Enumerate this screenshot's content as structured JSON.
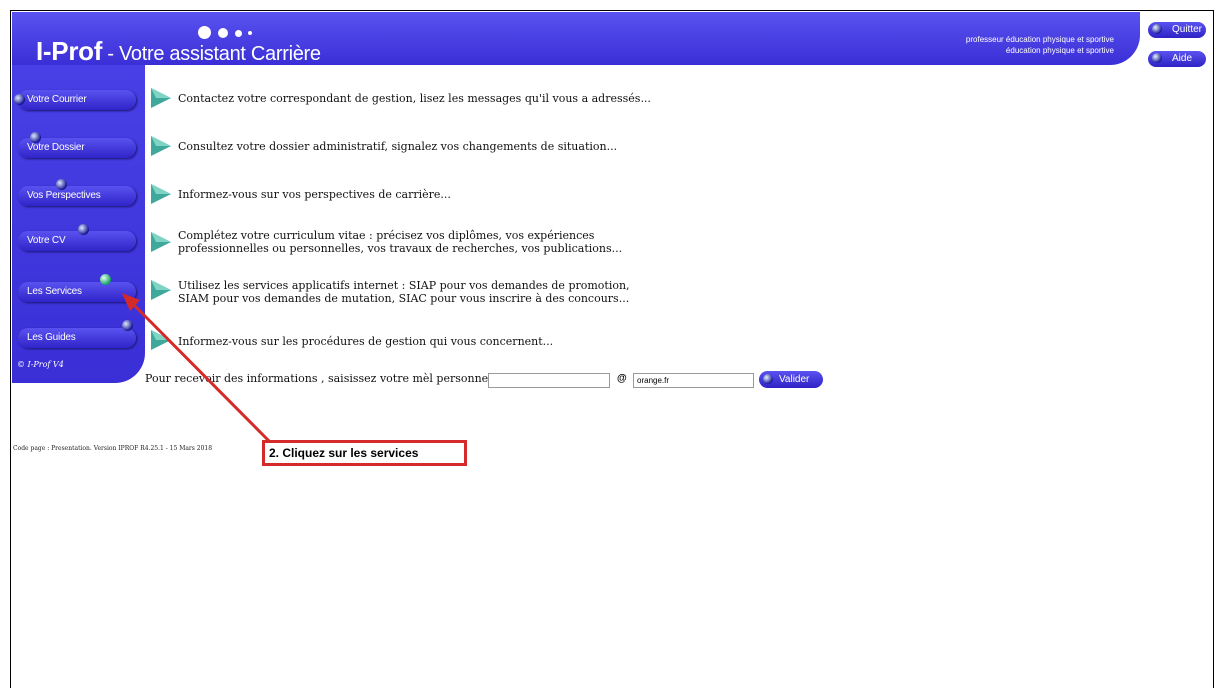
{
  "header": {
    "brand": "I-Prof",
    "tagline": " - Votre assistant Carrière",
    "user_line1": "professeur éducation physique et sportive",
    "user_line2": "éducation physique et sportive",
    "quit_label": "Quitter",
    "help_label": "Aide"
  },
  "sidebar": {
    "items": [
      {
        "label": "Votre Courrier"
      },
      {
        "label": "Votre Dossier"
      },
      {
        "label": "Vos Perspectives"
      },
      {
        "label": "Votre CV"
      },
      {
        "label": "Les Services"
      },
      {
        "label": "Les Guides"
      }
    ],
    "copyright": "© I-Prof  V4"
  },
  "main": {
    "rows": [
      {
        "text": "Contactez votre correspondant de gestion, lisez les messages qu'il vous a adressés..."
      },
      {
        "text": "Consultez votre dossier administratif, signalez vos changements de situation..."
      },
      {
        "text": "Informez-vous sur vos perspectives de carrière..."
      },
      {
        "line1": "Complétez votre curriculum vitae : précisez vos diplômes, vos expériences",
        "line2": "professionnelles ou personnelles, vos travaux de recherches, vos publications..."
      },
      {
        "line1": "Utilisez les services applicatifs internet : SIAP pour vos demandes de promotion,",
        "line2": "SIAM pour vos demandes de mutation, SIAC pour vous inscrire à des concours..."
      },
      {
        "text": "Informez-vous sur les procédures de gestion qui vous concernent..."
      }
    ],
    "mail_prompt": "Pour recevoir des informations , saisissez votre mèl personnel :",
    "mail_value": "",
    "at": "@",
    "domain_value": "orange.fr",
    "submit_label": "Valider"
  },
  "footer": {
    "code_page": "Code page : Presentation. Version IPROF R4.25.1 - 15 Mars 2018"
  },
  "annotation": {
    "text": "2. Cliquez sur les services",
    "color": "#d42a2a"
  }
}
